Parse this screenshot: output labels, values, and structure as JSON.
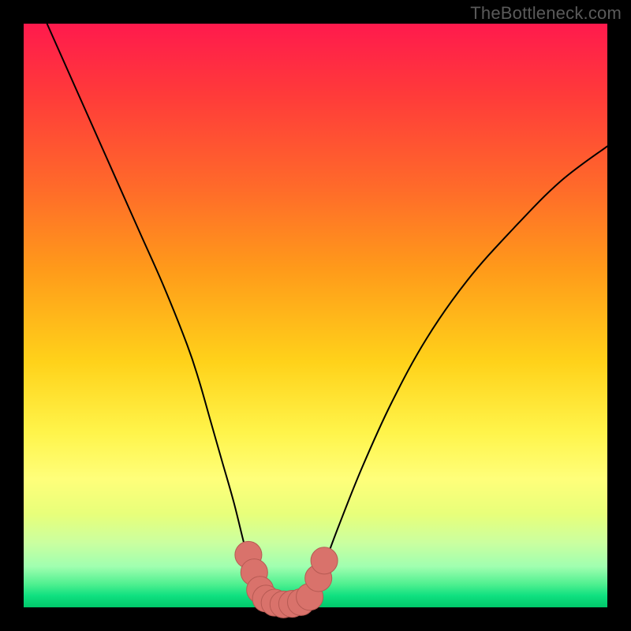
{
  "watermark": {
    "text": "TheBottleneck.com"
  },
  "colors": {
    "curve": "#000000",
    "dot_fill": "#d9726b",
    "dot_stroke": "#b65a53"
  },
  "chart_data": {
    "type": "line",
    "title": "",
    "xlabel": "",
    "ylabel": "",
    "xlim": [
      0,
      100
    ],
    "ylim": [
      0,
      100
    ],
    "grid": false,
    "legend": false,
    "series": [
      {
        "name": "left-curve",
        "x": [
          4,
          8,
          12,
          16,
          20,
          24,
          28,
          30,
          32,
          34,
          36,
          38,
          39.5,
          41
        ],
        "y": [
          100,
          91,
          82,
          73,
          64,
          55,
          45,
          39,
          32,
          25,
          18,
          10,
          5,
          1
        ]
      },
      {
        "name": "right-curve",
        "x": [
          49,
          51,
          54,
          58,
          63,
          69,
          76,
          84,
          92,
          100
        ],
        "y": [
          1,
          6,
          14,
          24,
          35,
          46,
          56,
          65,
          73,
          79
        ]
      },
      {
        "name": "valley-flat",
        "x": [
          41,
          43,
          45,
          47,
          49
        ],
        "y": [
          1,
          0.6,
          0.5,
          0.6,
          1
        ]
      }
    ],
    "markers": [
      {
        "x": 38.5,
        "y": 9,
        "r": 2.3
      },
      {
        "x": 39.5,
        "y": 6,
        "r": 2.3
      },
      {
        "x": 40.5,
        "y": 3,
        "r": 2.3
      },
      {
        "x": 41.5,
        "y": 1.5,
        "r": 2.3
      },
      {
        "x": 43,
        "y": 0.8,
        "r": 2.3
      },
      {
        "x": 44.5,
        "y": 0.5,
        "r": 2.3
      },
      {
        "x": 46,
        "y": 0.6,
        "r": 2.3
      },
      {
        "x": 47.5,
        "y": 0.9,
        "r": 2.3
      },
      {
        "x": 49,
        "y": 1.8,
        "r": 2.3
      },
      {
        "x": 50.5,
        "y": 5,
        "r": 2.3
      },
      {
        "x": 51.5,
        "y": 8,
        "r": 2.3
      }
    ]
  }
}
